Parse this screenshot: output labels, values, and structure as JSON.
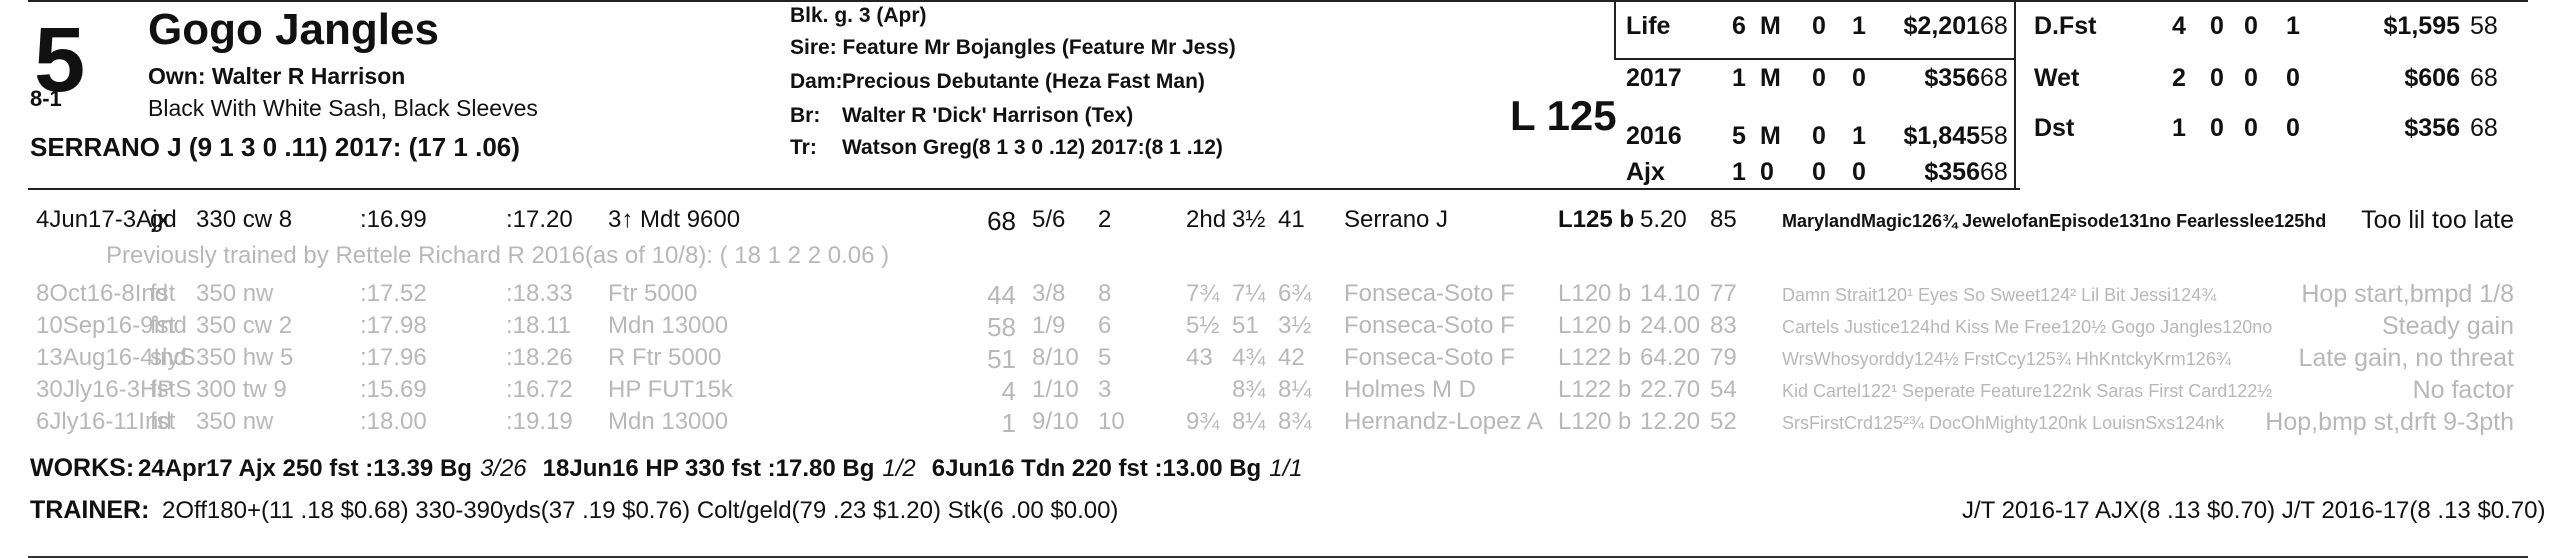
{
  "horse": {
    "program_number": "5",
    "morning_line": "8-1",
    "name": "Gogo Jangles",
    "owner": "Own: Walter R Harrison",
    "silks": "Black With White Sash, Black Sleeves",
    "jockey": "SERRANO J (9 1 3 0 .11) 2017: (17 1 .06)",
    "description": "Blk. g. 3 (Apr)",
    "sire": "Sire: Feature Mr Bojangles (Feature Mr Jess)",
    "dam_label": "Dam:",
    "dam": "Precious Debutante (Heza Fast Man)",
    "breeder_label": "Br:",
    "breeder": "Walter R 'Dick' Harrison (Tex)",
    "trainer_label": "Tr:",
    "trainer": "Watson Greg(8 1 3 0 .12) 2017:(8 1 .12)",
    "weight": "L 125"
  },
  "records_left": [
    {
      "label": "Life",
      "starts": "6",
      "m": "M",
      "a": "0",
      "b": "1",
      "earn": "$2,201",
      "fig": "68"
    },
    {
      "label": "2017",
      "starts": "1",
      "m": "M",
      "a": "0",
      "b": "0",
      "earn": "$356",
      "fig": "68"
    },
    {
      "label": "2016",
      "starts": "5",
      "m": "M",
      "a": "0",
      "b": "1",
      "earn": "$1,845",
      "fig": "58"
    },
    {
      "label": "Ajx",
      "starts": "1",
      "m": "0",
      "a": "0",
      "b": "0",
      "earn": "$356",
      "fig": "68"
    }
  ],
  "records_right": [
    {
      "label": "D.Fst",
      "starts": "4",
      "m": "0",
      "a": "0",
      "b": "1",
      "earn": "$1,595",
      "fig": "58"
    },
    {
      "label": "Wet",
      "starts": "2",
      "m": "0",
      "a": "0",
      "b": "0",
      "earn": "$606",
      "fig": "68"
    },
    {
      "label": "Dst",
      "starts": "1",
      "m": "0",
      "a": "0",
      "b": "0",
      "earn": "$356",
      "fig": "68"
    }
  ],
  "main_race": {
    "date": "4Jun17-3Ajx",
    "cond": "gd",
    "dist": "330 cw 8",
    "f1": ":16.99",
    "f2": ":17.20",
    "race": "3↑ Mdt 9600",
    "fig": "68",
    "pp": "5/6",
    "st": "2",
    "c1": "2hd",
    "c2": "3½",
    "fin": "41",
    "jockey": "Serrano J",
    "wt": "L125 b",
    "odds": "5.20",
    "spd": "85",
    "comp": "MarylandMagic126¾ JewelofanEpisode131no Fearlesslee125hd",
    "comment": "Too lil too late"
  },
  "trainer_note": "Previously trained by Rettele Richard R 2016(as of 10/8): ( 18 1 2 2 0.06 )",
  "past_races": [
    {
      "date": "8Oct16-8Ind",
      "cond": "fst",
      "dist": "350 nw",
      "f1": ":17.52",
      "f2": ":18.33",
      "race": "Ftr 5000",
      "fig": "44",
      "pp": "3/8",
      "st": "8",
      "c1": "7¾",
      "c2": "7¼",
      "fin": "6¾",
      "jockey": "Fonseca-Soto F",
      "wt": "L120 b",
      "odds": "14.10",
      "spd": "77",
      "comp": "Damn Strait120¹ Eyes So Sweet124² Lil Bit Jessi124¾",
      "comment": "Hop start,bmpd 1/8"
    },
    {
      "date": "10Sep16-9Ind",
      "cond": "fst",
      "dist": "350 cw 2",
      "f1": ":17.98",
      "f2": ":18.11",
      "race": "Mdn 13000",
      "fig": "58",
      "pp": "1/9",
      "st": "6",
      "c1": "5½",
      "c2": "51",
      "fin": "3½",
      "jockey": "Fonseca-Soto F",
      "wt": "L120 b",
      "odds": "24.00",
      "spd": "83",
      "comp": "Cartels Justice124hd Kiss Me Free120½ Gogo Jangles120no",
      "comment": "Steady gain"
    },
    {
      "date": "13Aug16-4Ind",
      "cond": "slyS",
      "dist": "350 hw 5",
      "f1": ":17.96",
      "f2": ":18.26",
      "race": "R Ftr 5000",
      "fig": "51",
      "pp": "8/10",
      "st": "5",
      "c1": "43",
      "c2": "4¾",
      "fin": "42",
      "jockey": "Fonseca-Soto F",
      "wt": "L122 b",
      "odds": "64.20",
      "spd": "79",
      "comp": "WrsWhosyorddy124½ FrstCcy125¾ HhKntckyKrm126¾",
      "comment": "Late gain, no threat"
    },
    {
      "date": "30Jly16-3HP",
      "cond": "fstS",
      "dist": "300 tw 9",
      "f1": ":15.69",
      "f2": ":16.72",
      "race": "HP FUT15k",
      "fig": "4",
      "pp": "1/10",
      "st": "3",
      "c1": "",
      "c2": "8¾",
      "fin": "8¼",
      "jockey": "Holmes M D",
      "wt": "L122 b",
      "odds": "22.70",
      "spd": "54",
      "comp": "Kid Cartel122¹ Seperate Feature122nk Saras First Card122½",
      "comment": "No factor"
    },
    {
      "date": "6Jly16-11Ind",
      "cond": "fst",
      "dist": "350 nw",
      "f1": ":18.00",
      "f2": ":19.19",
      "race": "Mdn 13000",
      "fig": "1",
      "pp": "9/10",
      "st": "10",
      "c1": "9¾",
      "c2": "8¼",
      "fin": "8¾",
      "jockey": "Hernandz-Lopez A",
      "wt": "L120 b",
      "odds": "12.20",
      "spd": "52",
      "comp": "SrsFirstCrd125²¾ DocOhMighty120nk LouisnSxs124nk",
      "comment": "Hop,bmp st,drft 9-3pth"
    }
  ],
  "works": {
    "label": "WORKS:",
    "items": [
      {
        "text": "24Apr17 Ajx 250 fst :13.39 Bg",
        "rank": "3/26"
      },
      {
        "text": "18Jun16 HP 330 fst :17.80 Bg",
        "rank": "1/2"
      },
      {
        "text": "6Jun16 Tdn 220 fst :13.00 Bg",
        "rank": "1/1"
      }
    ]
  },
  "trainer_stats": {
    "label": "TRAINER:",
    "text": "2Off180+(11 .18 $0.68) 330-390yds(37 .19 $0.76) Colt/geld(79 .23 $1.20) Stk(6 .00 $0.00)",
    "jt": "J/T 2016-17 AJX(8 .13 $0.70)  J/T 2016-17(8 .13 $0.70)"
  }
}
